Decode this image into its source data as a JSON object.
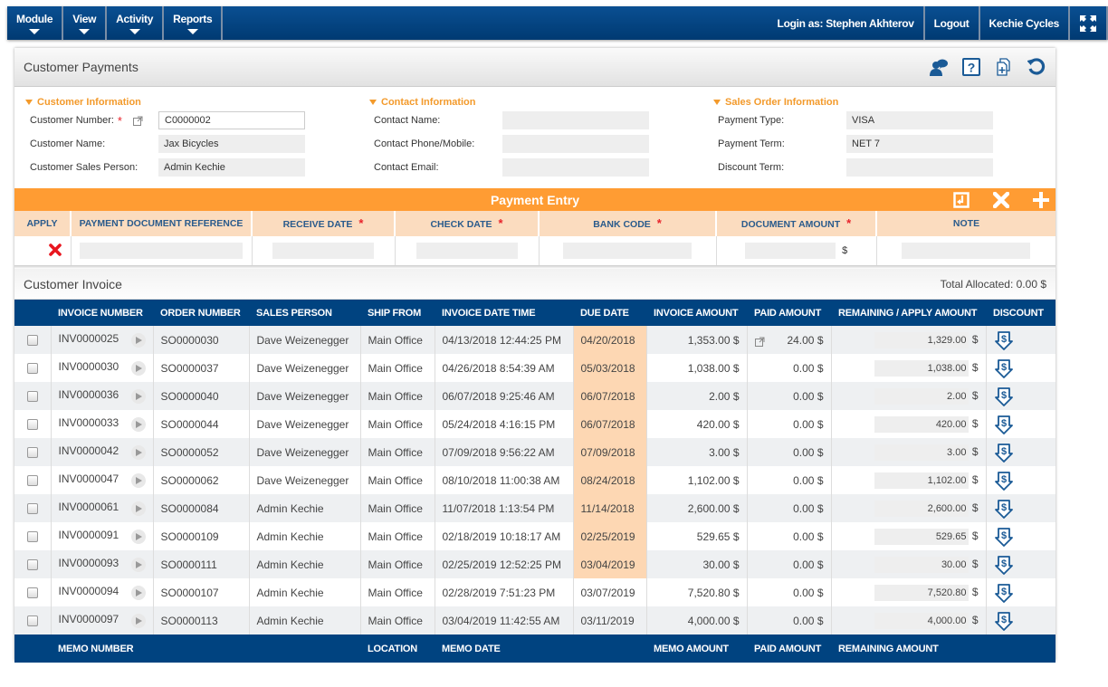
{
  "nav": {
    "menus": [
      {
        "label": "Module"
      },
      {
        "label": "View"
      },
      {
        "label": "Activity"
      },
      {
        "label": "Reports"
      }
    ],
    "login_label": "Login as: Stephen Akhterov",
    "logout_label": "Logout",
    "company_label": "Kechie Cycles",
    "fullscreen_icon": "expand-icon"
  },
  "page": {
    "title": "Customer Payments",
    "header_icons": [
      "support-chat-icon",
      "help-icon",
      "copy-document-icon",
      "refresh-icon"
    ]
  },
  "customer_info": {
    "heading": "Customer Information",
    "customer_number_label": "Customer Number:",
    "customer_number_value": "C0000002",
    "customer_name_label": "Customer Name:",
    "customer_name_value": "Jax Bicycles",
    "sales_person_label": "Customer Sales Person:",
    "sales_person_value": "Admin Kechie"
  },
  "contact_info": {
    "heading": "Contact Information",
    "name_label": "Contact Name:",
    "name_value": "",
    "phone_label": "Contact Phone/Mobile:",
    "phone_value": "",
    "email_label": "Contact Email:",
    "email_value": ""
  },
  "sales_order_info": {
    "heading": "Sales Order Information",
    "payment_type_label": "Payment Type:",
    "payment_type_value": "VISA",
    "payment_term_label": "Payment Term:",
    "payment_term_value": "NET 7",
    "discount_term_label": "Discount Term:",
    "discount_term_value": ""
  },
  "payment_entry": {
    "title": "Payment Entry",
    "actions": [
      "import-icon",
      "close-icon",
      "add-icon"
    ],
    "columns": {
      "apply": "APPLY",
      "doc_ref": "PAYMENT DOCUMENT REFERENCE",
      "receive_date": "RECEIVE DATE",
      "check_date": "CHECK DATE",
      "bank_code": "BANK CODE",
      "doc_amount": "DOCUMENT AMOUNT",
      "note": "NOTE"
    },
    "required_marker": "*",
    "currency": "$"
  },
  "invoice": {
    "title": "Customer Invoice",
    "total_allocated": "Total Allocated: 0.00 $",
    "columns": [
      "",
      "INVOICE NUMBER",
      "ORDER NUMBER",
      "SALES PERSON",
      "SHIP FROM",
      "INVOICE DATE TIME",
      "DUE DATE",
      "INVOICE AMOUNT",
      "PAID AMOUNT",
      "REMAINING / APPLY AMOUNT",
      "DISCOUNT"
    ],
    "rows": [
      {
        "invoice": "INV0000025",
        "order": "SO0000030",
        "sales": "Dave Weizenegger",
        "ship": "Main Office",
        "date": "04/13/2018 12:44:25 PM",
        "due": "04/20/2018",
        "overdue": true,
        "amount": "1,353.00 $",
        "paid": "24.00 $",
        "paid_link": true,
        "remaining": "1,329.00",
        "currency": "$"
      },
      {
        "invoice": "INV0000030",
        "order": "SO0000037",
        "sales": "Dave Weizenegger",
        "ship": "Main Office",
        "date": "04/26/2018 8:54:39 AM",
        "due": "05/03/2018",
        "overdue": true,
        "amount": "1,038.00 $",
        "paid": "0.00 $",
        "paid_link": false,
        "remaining": "1,038.00",
        "currency": "$"
      },
      {
        "invoice": "INV0000036",
        "order": "SO0000040",
        "sales": "Dave Weizenegger",
        "ship": "Main Office",
        "date": "06/07/2018 9:25:46 AM",
        "due": "06/07/2018",
        "overdue": true,
        "amount": "2.00 $",
        "paid": "0.00 $",
        "paid_link": false,
        "remaining": "2.00",
        "currency": "$"
      },
      {
        "invoice": "INV0000033",
        "order": "SO0000044",
        "sales": "Dave Weizenegger",
        "ship": "Main Office",
        "date": "05/24/2018 4:16:15 PM",
        "due": "06/07/2018",
        "overdue": true,
        "amount": "420.00 $",
        "paid": "0.00 $",
        "paid_link": false,
        "remaining": "420.00",
        "currency": "$"
      },
      {
        "invoice": "INV0000042",
        "order": "SO0000052",
        "sales": "Dave Weizenegger",
        "ship": "Main Office",
        "date": "07/09/2018 9:56:22 AM",
        "due": "07/09/2018",
        "overdue": true,
        "amount": "3.00 $",
        "paid": "0.00 $",
        "paid_link": false,
        "remaining": "3.00",
        "currency": "$"
      },
      {
        "invoice": "INV0000047",
        "order": "SO0000062",
        "sales": "Dave Weizenegger",
        "ship": "Main Office",
        "date": "08/10/2018 11:00:38 AM",
        "due": "08/24/2018",
        "overdue": true,
        "amount": "1,102.00 $",
        "paid": "0.00 $",
        "paid_link": false,
        "remaining": "1,102.00",
        "currency": "$"
      },
      {
        "invoice": "INV0000061",
        "order": "SO0000084",
        "sales": "Admin Kechie",
        "ship": "Main Office",
        "date": "11/07/2018 1:13:54 PM",
        "due": "11/14/2018",
        "overdue": true,
        "amount": "2,600.00 $",
        "paid": "0.00 $",
        "paid_link": false,
        "remaining": "2,600.00",
        "currency": "$"
      },
      {
        "invoice": "INV0000091",
        "order": "SO0000109",
        "sales": "Admin Kechie",
        "ship": "Main Office",
        "date": "02/18/2019 10:18:17 AM",
        "due": "02/25/2019",
        "overdue": true,
        "amount": "529.65 $",
        "paid": "0.00 $",
        "paid_link": false,
        "remaining": "529.65",
        "currency": "$"
      },
      {
        "invoice": "INV0000093",
        "order": "SO0000111",
        "sales": "Admin Kechie",
        "ship": "Main Office",
        "date": "02/25/2019 12:52:25 PM",
        "due": "03/04/2019",
        "overdue": true,
        "amount": "30.00 $",
        "paid": "0.00 $",
        "paid_link": false,
        "remaining": "30.00",
        "currency": "$"
      },
      {
        "invoice": "INV0000094",
        "order": "SO0000107",
        "sales": "Admin Kechie",
        "ship": "Main Office",
        "date": "02/28/2019 7:51:23 PM",
        "due": "03/07/2019",
        "overdue": false,
        "amount": "7,520.80 $",
        "paid": "0.00 $",
        "paid_link": false,
        "remaining": "7,520.80",
        "currency": "$"
      },
      {
        "invoice": "INV0000097",
        "order": "SO0000113",
        "sales": "Admin Kechie",
        "ship": "Main Office",
        "date": "03/04/2019 11:42:55 AM",
        "due": "03/11/2019",
        "overdue": false,
        "amount": "4,000.00 $",
        "paid": "0.00 $",
        "paid_link": false,
        "remaining": "4,000.00",
        "currency": "$"
      }
    ],
    "memo_columns": [
      "",
      "MEMO NUMBER",
      "",
      "",
      "LOCATION",
      "MEMO DATE",
      "",
      "MEMO AMOUNT",
      "PAID AMOUNT",
      "REMAINING AMOUNT",
      ""
    ]
  },
  "colors": {
    "nav_bg": "#004380",
    "accent_orange": "#ff9c33",
    "section_orange": "#f39a2b",
    "overdue_highlight": "#fdd7b3",
    "required_red": "#e8222a",
    "icon_blue": "#1a5a96"
  }
}
